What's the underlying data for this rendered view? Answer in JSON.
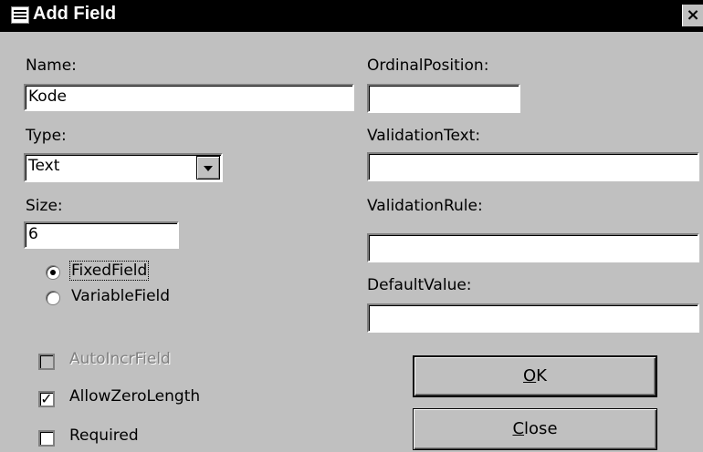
{
  "window": {
    "title": "Add Field",
    "close_glyph": "×",
    "icon": "database-icon"
  },
  "left": {
    "name_label": "Name:",
    "name_value": "Kode",
    "type_label": "Type:",
    "type_value": "Text",
    "size_label": "Size:",
    "size_value": "6",
    "radio_fixed": "FixedField",
    "radio_variable": "VariableField",
    "radio_selected": "FixedField",
    "check_autoincr": "AutoIncrField",
    "check_allowzero": "AllowZeroLength",
    "check_required": "Required",
    "autoincr_checked": false,
    "allowzero_checked": true,
    "required_checked": false,
    "checkmark": "✓"
  },
  "right": {
    "ordinal_label": "OrdinalPosition:",
    "ordinal_value": "",
    "validation_text_label": "ValidationText:",
    "validation_text_value": "",
    "validation_rule_label": "ValidationRule:",
    "validation_rule_value": "",
    "default_value_label": "DefaultValue:",
    "default_value_value": ""
  },
  "buttons": {
    "ok_mnemonic": "O",
    "ok_rest": "K",
    "close_mnemonic": "C",
    "close_rest": "lose"
  }
}
